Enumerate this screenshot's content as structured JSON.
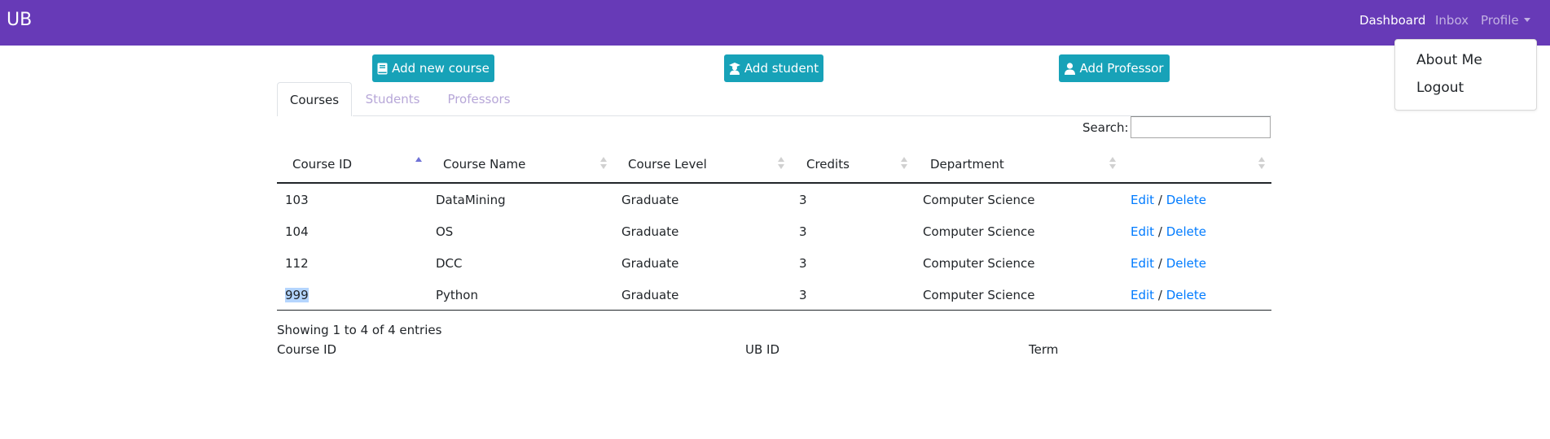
{
  "navbar": {
    "brand": "UB",
    "links": [
      {
        "label": "Dashboard"
      },
      {
        "label": "Inbox"
      },
      {
        "label": "Profile"
      }
    ],
    "profile_menu": [
      {
        "label": "About Me"
      },
      {
        "label": "Logout"
      }
    ]
  },
  "actions": {
    "add_course": "Add new course",
    "add_student": "Add student",
    "add_professor": "Add Professor"
  },
  "tabs": [
    {
      "label": "Courses",
      "active": true
    },
    {
      "label": "Students",
      "active": false
    },
    {
      "label": "Professors",
      "active": false
    }
  ],
  "search": {
    "label": "Search:",
    "value": ""
  },
  "table": {
    "columns": [
      "Course ID",
      "Course Name",
      "Course Level",
      "Credits",
      "Department",
      ""
    ],
    "sorted_by": "Course ID",
    "sort_direction": "ascending",
    "rows": [
      {
        "id": "103",
        "name": "DataMining",
        "level": "Graduate",
        "credits": "3",
        "dept": "Computer Science",
        "edit": "Edit",
        "sep": "/",
        "delete": "Delete"
      },
      {
        "id": "104",
        "name": "OS",
        "level": "Graduate",
        "credits": "3",
        "dept": "Computer Science",
        "edit": "Edit",
        "sep": "/",
        "delete": "Delete"
      },
      {
        "id": "112",
        "name": "DCC",
        "level": "Graduate",
        "credits": "3",
        "dept": "Computer Science",
        "edit": "Edit",
        "sep": "/",
        "delete": "Delete"
      },
      {
        "id": "999",
        "name": "Python",
        "level": "Graduate",
        "credits": "3",
        "dept": "Computer Science",
        "edit": "Edit",
        "sep": "/",
        "delete": "Delete"
      }
    ],
    "info": "Showing 1 to 4 of 4 entries"
  },
  "sub_headers": [
    "Course ID",
    "UB ID",
    "Term"
  ],
  "colors": {
    "navbar": "#673ab7",
    "button": "#17a2b8",
    "link": "#007bff",
    "selection": "#b4d5fe"
  }
}
